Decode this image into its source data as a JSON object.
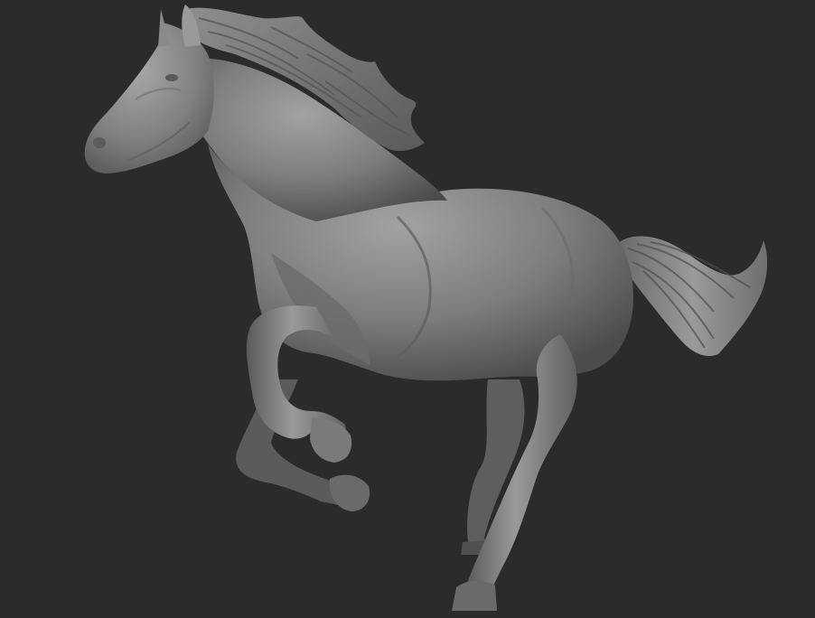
{
  "scene": {
    "background_color": "#2b2b2b",
    "model_base_color": "#8a8a8a",
    "model_shadow_color": "#4a4a4a",
    "model_highlight_color": "#b0b0b0",
    "subject": "horse-sculpt"
  }
}
